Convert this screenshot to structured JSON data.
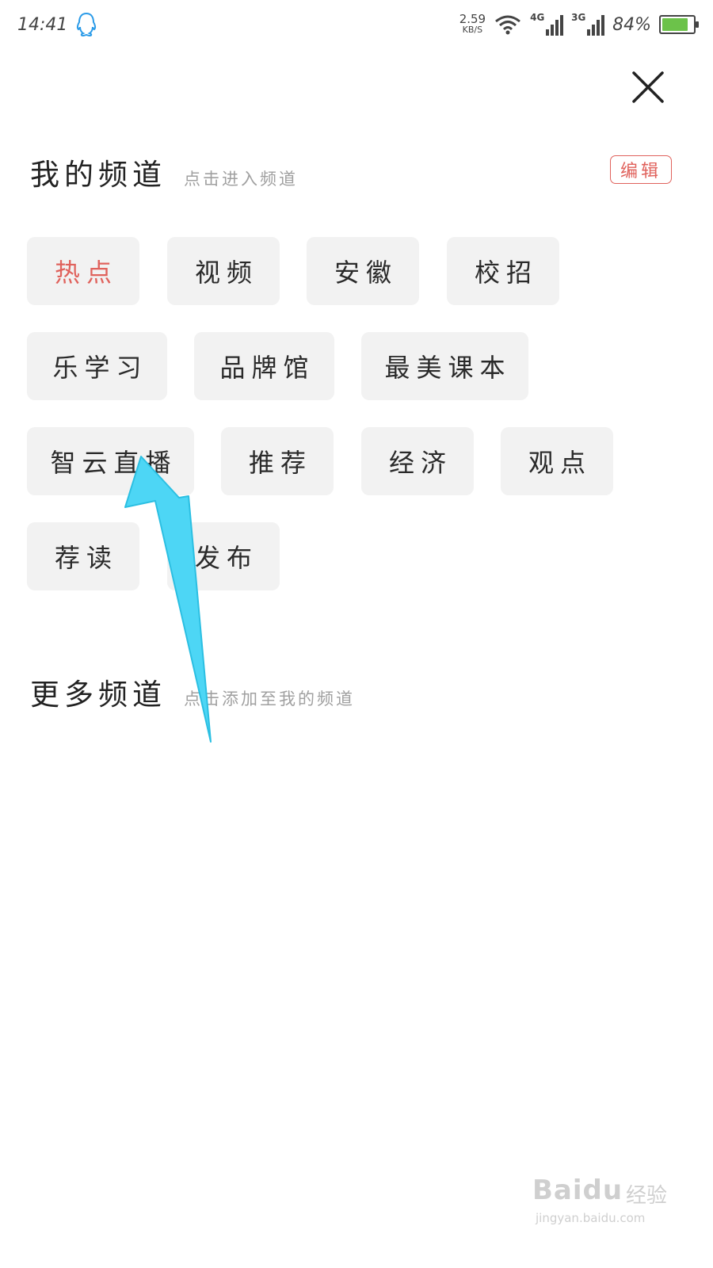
{
  "status_bar": {
    "time": "14:41",
    "net_speed_value": "2.59",
    "net_speed_unit": "KB/S",
    "signal_1_tag": "4G",
    "signal_2_tag": "3G",
    "battery_percent": "84%",
    "battery_level": 0.84
  },
  "my_channels": {
    "title": "我的频道",
    "hint": "点击进入频道",
    "edit_label": "编辑",
    "items": [
      "热点",
      "视频",
      "安徽",
      "校招",
      "乐学习",
      "品牌馆",
      "最美课本",
      "智云直播",
      "推荐",
      "经济",
      "观点",
      "荐读",
      "发布"
    ]
  },
  "more_channels": {
    "title": "更多频道",
    "hint": "点击添加至我的频道"
  },
  "watermark": {
    "brand": "Baidu",
    "cn": "经验",
    "url": "jingyan.baidu.com"
  },
  "colors": {
    "accent": "#e0625c",
    "chip_bg": "#f2f2f2",
    "annotation_arrow": "#4dd6f5",
    "battery": "#6cc24a"
  }
}
